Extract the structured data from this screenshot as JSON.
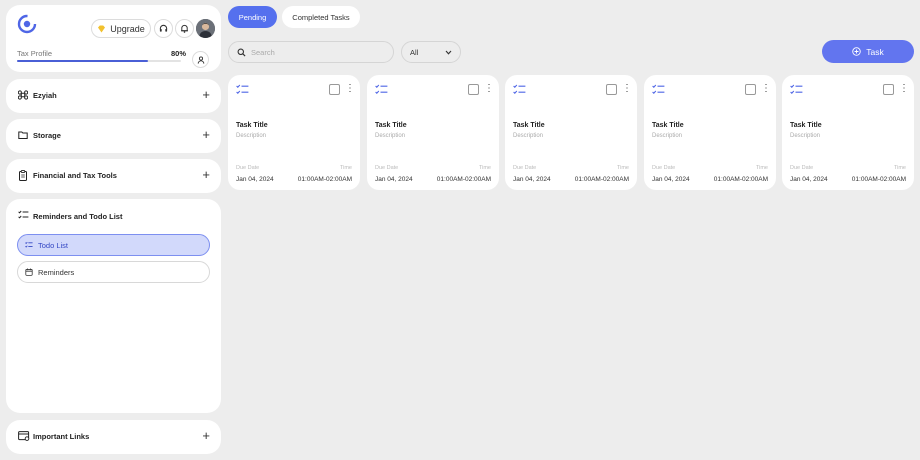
{
  "colors": {
    "accent": "#5570ee",
    "active_item_bg": "#d2d9fb",
    "page_bg": "#ededed"
  },
  "profile": {
    "upgrade_label": "Upgrade",
    "tax_profile_label": "Tax Profile",
    "tax_profile_value": "80%",
    "tax_profile_progress": 0.8
  },
  "sidebar": {
    "sections": [
      {
        "label": "Ezyiah",
        "icon": "command-icon"
      },
      {
        "label": "Storage",
        "icon": "folder-icon"
      },
      {
        "label": "Financial and Tax Tools",
        "icon": "clipboard-icon"
      }
    ],
    "reminders": {
      "label": "Reminders and Todo List",
      "items": [
        {
          "label": "Todo List",
          "icon": "checklist-icon",
          "active": true
        },
        {
          "label": "Reminders",
          "icon": "calendar-icon",
          "active": false
        }
      ]
    },
    "important_links": {
      "label": "Important Links",
      "icon": "browser-link-icon"
    }
  },
  "tabs": [
    {
      "label": "Pending",
      "active": true
    },
    {
      "label": "Completed Tasks",
      "active": false
    }
  ],
  "search": {
    "placeholder": "Search",
    "value": ""
  },
  "filter": {
    "selected": "All"
  },
  "task_button_label": "Task",
  "cards": [
    {
      "title": "Task Title",
      "description": "Description",
      "due_label": "Due Date",
      "due_value": "Jan 04, 2024",
      "time_label": "Time",
      "time_value": "01:00AM-02:00AM"
    },
    {
      "title": "Task Title",
      "description": "Description",
      "due_label": "Due Date",
      "due_value": "Jan 04, 2024",
      "time_label": "Time",
      "time_value": "01:00AM-02:00AM"
    },
    {
      "title": "Task Title",
      "description": "Description",
      "due_label": "Due Date",
      "due_value": "Jan 04, 2024",
      "time_label": "Time",
      "time_value": "01:00AM-02:00AM"
    },
    {
      "title": "Task Title",
      "description": "Description",
      "due_label": "Due Date",
      "due_value": "Jan 04, 2024",
      "time_label": "Time",
      "time_value": "01:00AM-02:00AM"
    },
    {
      "title": "Task Title",
      "description": "Description",
      "due_label": "Due Date",
      "due_value": "Jan 04, 2024",
      "time_label": "Time",
      "time_value": "01:00AM-02:00AM"
    }
  ]
}
